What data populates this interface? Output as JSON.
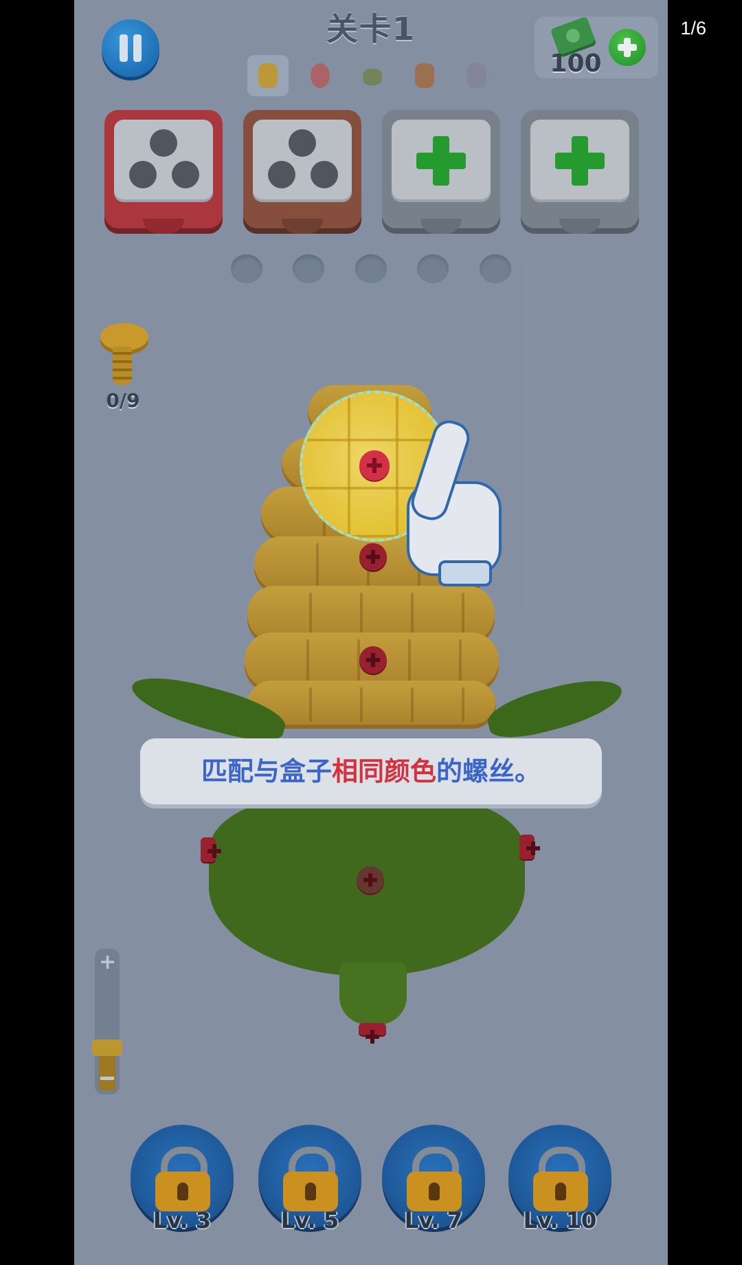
{
  "viewer": {
    "counter": "1/6"
  },
  "header": {
    "level_title": "关卡1",
    "money": "100"
  },
  "stages": [
    {
      "icon": "corn-icon",
      "active": true
    },
    {
      "icon": "bird-icon",
      "active": false
    },
    {
      "icon": "house-icon",
      "active": false
    },
    {
      "icon": "rooster-icon",
      "active": false
    },
    {
      "icon": "robot-icon",
      "active": false
    }
  ],
  "boxes": [
    {
      "color": "red",
      "state": "three-holes"
    },
    {
      "color": "brown",
      "state": "three-holes"
    },
    {
      "color": "gray",
      "state": "add"
    },
    {
      "color": "gray",
      "state": "add"
    }
  ],
  "screw_counter": "0/9",
  "tip": {
    "part1": "匹配与盒子",
    "highlight": "相同颜色",
    "part2": "的螺丝。"
  },
  "boosters": [
    {
      "label": "Lv. 3"
    },
    {
      "label": "Lv. 5"
    },
    {
      "label": "Lv. 7"
    },
    {
      "label": "Lv. 10"
    }
  ],
  "colors": {
    "accent_blue": "#1565b0",
    "highlight_red": "#e2343f",
    "tip_blue": "#3f6bd4",
    "add_green": "#27a52e"
  }
}
